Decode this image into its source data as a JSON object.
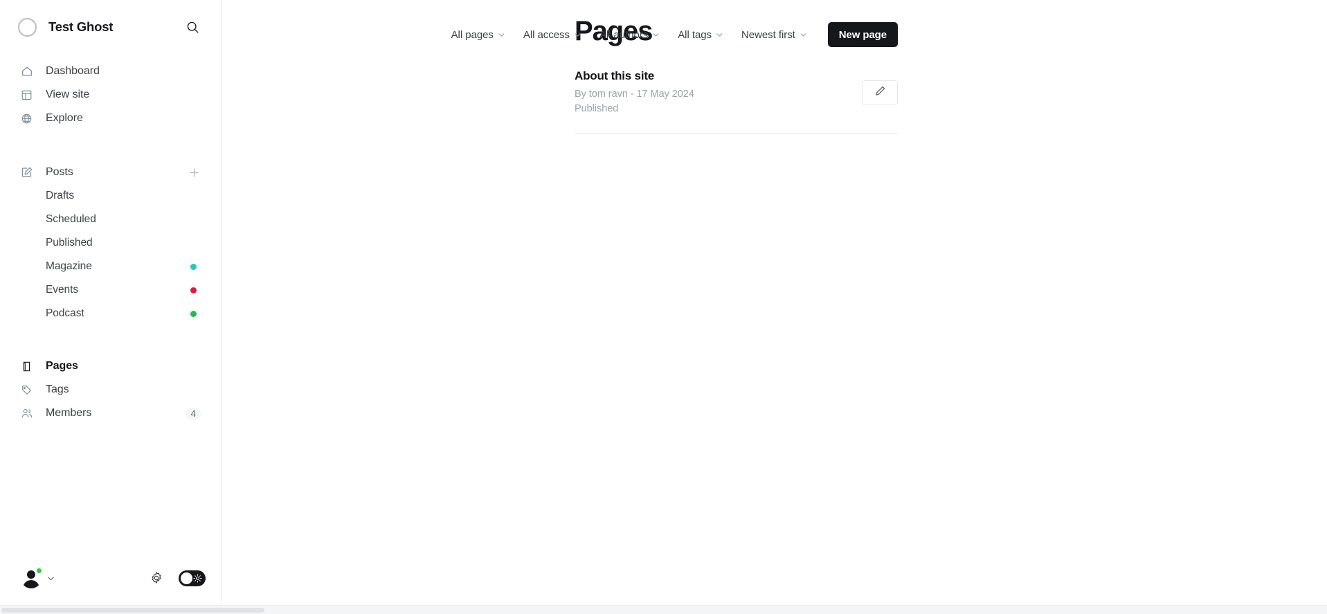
{
  "sidebar": {
    "brand": {
      "name": "Test Ghost",
      "logo_icon": "ghost-logo-circle",
      "search_icon": "search-icon"
    },
    "main_items": [
      {
        "label": "Dashboard",
        "icon": "home-icon",
        "active": false
      },
      {
        "label": "View site",
        "icon": "layout-icon",
        "active": false
      },
      {
        "label": "Explore",
        "icon": "globe-icon",
        "active": false
      }
    ],
    "posts_group": {
      "parent": {
        "label": "Posts",
        "icon": "pencil-square-icon",
        "add_icon": "plus-icon"
      },
      "children": [
        {
          "label": "Drafts",
          "dot": ""
        },
        {
          "label": "Scheduled",
          "dot": ""
        },
        {
          "label": "Published",
          "dot": ""
        },
        {
          "label": "Magazine",
          "dot": "#26c6c6"
        },
        {
          "label": "Events",
          "dot": "#e8173f"
        },
        {
          "label": "Podcast",
          "dot": "#1bbf4c"
        }
      ]
    },
    "pages_group": [
      {
        "label": "Pages",
        "icon": "book-icon",
        "active": true,
        "badge": ""
      },
      {
        "label": "Tags",
        "icon": "tag-icon",
        "active": false,
        "badge": ""
      },
      {
        "label": "Members",
        "icon": "members-icon",
        "active": false,
        "badge": "4"
      }
    ],
    "bottom": {
      "avatar_icon": "user-avatar",
      "online_status_color": "#30cf43",
      "chevron_icon": "chevron-down-icon",
      "settings_icon": "gear-icon",
      "theme_toggle_icon": "sun-icon",
      "theme_toggle_state": "light"
    }
  },
  "header": {
    "title": "Pages",
    "filters": [
      {
        "label": "All pages",
        "chevron_icon": "chevron-down-icon"
      },
      {
        "label": "All access",
        "chevron_icon": "chevron-down-icon"
      },
      {
        "label": "All authors",
        "chevron_icon": "chevron-down-icon"
      },
      {
        "label": "All tags",
        "chevron_icon": "chevron-down-icon"
      },
      {
        "label": "Newest first",
        "chevron_icon": "chevron-down-icon"
      }
    ],
    "new_page_label": "New page"
  },
  "list": {
    "rows": [
      {
        "title": "About this site",
        "meta": "By tom ravn - 17 May 2024",
        "status": "Published",
        "edit_icon": "pencil-icon"
      }
    ]
  },
  "colors": {
    "accent_dark": "#15171a",
    "muted_text": "#9aa3ab",
    "border": "#eceef0"
  }
}
